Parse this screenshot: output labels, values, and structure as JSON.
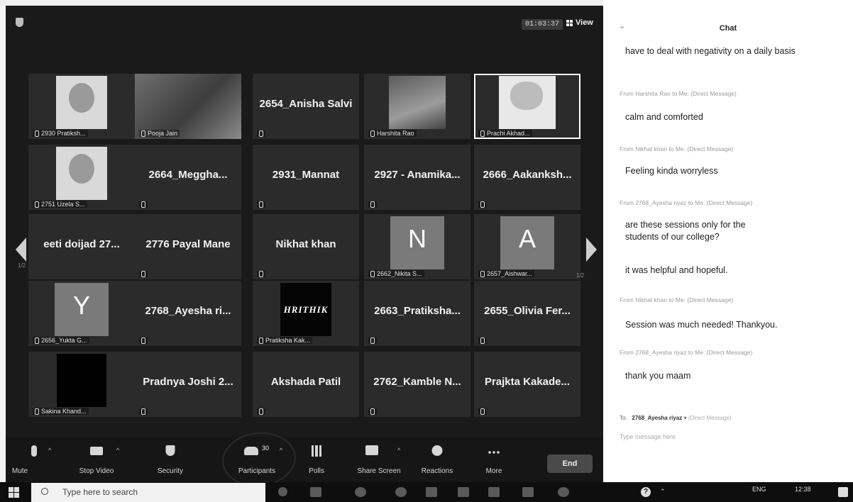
{
  "meeting": {
    "timer": "01:03:37",
    "view_label": "View",
    "page_left": "1/2",
    "page_right": "1/2"
  },
  "tiles": [
    {
      "big": "",
      "mini": "2930 Pratiksh...",
      "media": "avatar"
    },
    {
      "big": "",
      "mini": "Pooja Jain",
      "media": "photo"
    },
    {
      "big": "2654_Anisha Salvi",
      "mini": "",
      "media": "none"
    },
    {
      "big": "",
      "mini": "Harshita Rao",
      "media": "photo2"
    },
    {
      "big": "",
      "mini": "Prachi Akhad...",
      "media": "cartoon",
      "highlight": true
    },
    {
      "big": "",
      "mini": "2751 Uzela S...",
      "media": "avatar"
    },
    {
      "big": "2664_Meggha...",
      "mini": "",
      "media": "none"
    },
    {
      "big": "2931_Mannat",
      "mini": "",
      "media": "none"
    },
    {
      "big": "2927 - Anamika...",
      "mini": "",
      "media": "none"
    },
    {
      "big": "2666_Aakanksh...",
      "mini": "",
      "media": "none"
    },
    {
      "big": "eeti doijad 27...",
      "mini": "",
      "media": "none",
      "nomic": true
    },
    {
      "big": "2776 Payal Mane",
      "mini": "",
      "media": "none"
    },
    {
      "big": "Nikhat khan",
      "mini": "",
      "media": "none"
    },
    {
      "big": "",
      "mini": "2662_Nikita S...",
      "media": "letter",
      "letter": "N"
    },
    {
      "big": "",
      "mini": "2657_Aishwar...",
      "media": "letter",
      "letter": "A"
    },
    {
      "big": "",
      "mini": "2656_Yukta G...",
      "media": "letter",
      "letter": "Y"
    },
    {
      "big": "2768_Ayesha ri...",
      "mini": "",
      "media": "none"
    },
    {
      "big": "",
      "mini": "Pratiksha Kak...",
      "media": "logo",
      "logo_text": "HRITHIK"
    },
    {
      "big": "2663_Pratiksha...",
      "mini": "",
      "media": "none"
    },
    {
      "big": "2655_Olivia Fer...",
      "mini": "",
      "media": "none"
    },
    {
      "big": "",
      "mini": "Sakina Khand...",
      "media": "dark"
    },
    {
      "big": "Pradnya Joshi 2...",
      "mini": "",
      "media": "none"
    },
    {
      "big": "Akshada Patil",
      "mini": "",
      "media": "none"
    },
    {
      "big": "2762_Kamble N...",
      "mini": "",
      "media": "none"
    },
    {
      "big": "Prajkta Kakade...",
      "mini": "",
      "media": "none"
    }
  ],
  "toolbar": {
    "mute": "Mute",
    "stop_video": "Stop Video",
    "security": "Security",
    "participants": "Participants",
    "participants_count": "30",
    "polls": "Polls",
    "share_screen": "Share Screen",
    "reactions": "Reactions",
    "more": "More",
    "end": "End"
  },
  "chat": {
    "title": "Chat",
    "messages": [
      {
        "from": "",
        "text": "have to deal with negativity on a daily basis"
      },
      {
        "from": "From Harshita Rao to Me: (Direct Message)",
        "text": "calm and comforted"
      },
      {
        "from": "From Nikhat khan to Me: (Direct Message)",
        "text": "Feeling kinda worryless"
      },
      {
        "from": "From 2768_Ayesha riyaz to Me: (Direct Message)",
        "text": "are these sessions only for the students of our college?"
      },
      {
        "from": "",
        "text": "it was helpful and hopeful."
      },
      {
        "from": "From Nikhat khan to Me: (Direct Message)",
        "text": "Session was much needed! Thankyou."
      },
      {
        "from": "From 2768_Ayesha riyaz to Me: (Direct Message)",
        "text": "thank you maam"
      }
    ],
    "to_label": "To:",
    "to_value": "2768_Ayesha riyaz",
    "to_mode": "(Direct Message)",
    "placeholder": "Type message here"
  },
  "taskbar": {
    "search_placeholder": "Type here to search",
    "lang": "ENG",
    "time": "12:38"
  }
}
